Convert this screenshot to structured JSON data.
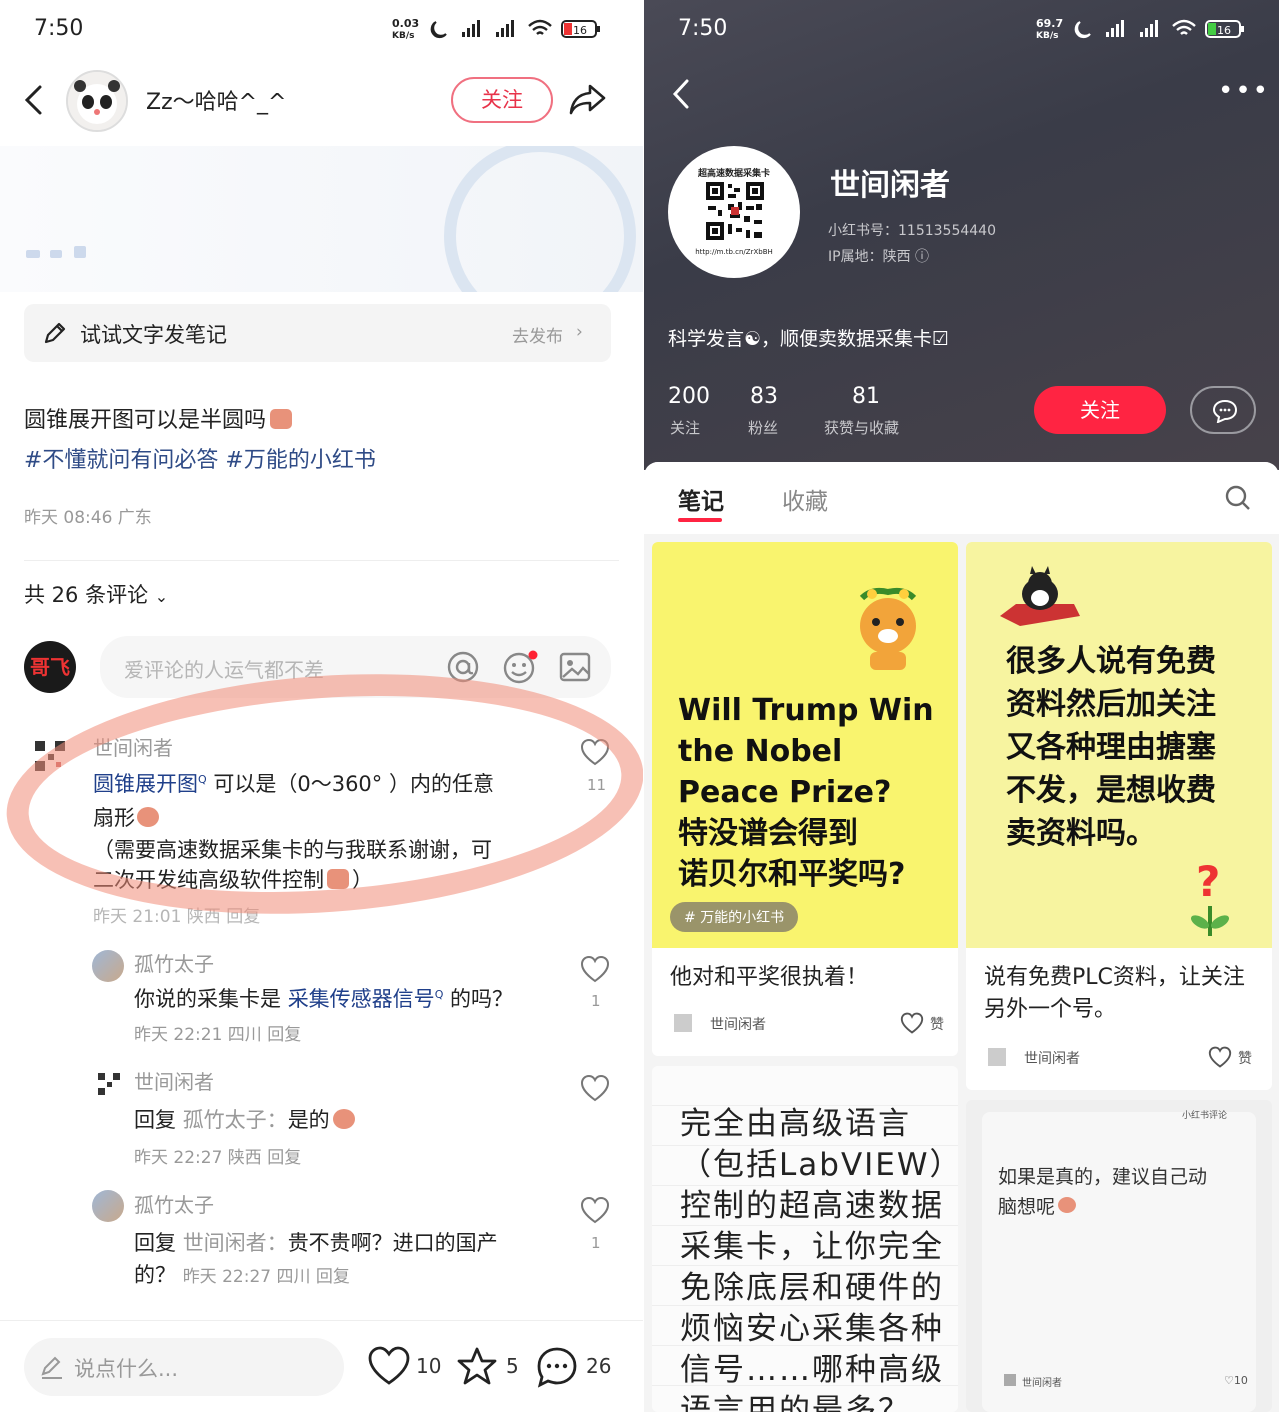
{
  "left": {
    "status": {
      "time": "7:50",
      "speed": "0.03\nKB/s",
      "battery": "16"
    },
    "header": {
      "username": "Zz～哈哈^_^",
      "follow_label": "关注"
    },
    "trybar": {
      "label": "试试文字发笔记",
      "action": "去发布"
    },
    "post": {
      "text": "圆锥展开图可以是半圆吗",
      "tags": "#不懂就问有问必答 #万能的小红书",
      "meta": "昨天 08:46 广东"
    },
    "comments_count": "共 26 条评论",
    "comment_placeholder": "爱评论的人运气都不差",
    "my_avatar_text": "哥飞",
    "comments": [
      {
        "author": "世间闲者",
        "link": "圆锥展开图",
        "text": " 可以是（0～360°  ）内的任意",
        "text2": "扇形",
        "text3": "（需要高速数据采集卡的与我联系谢谢，可",
        "text4": "二次开发纯高级软件控制",
        "text5": "）",
        "meta": "昨天 21:01 陕西  回复",
        "likes": "11"
      },
      {
        "author": "孤竹太子",
        "pre": "你说的采集卡是 ",
        "link": "采集传感器信号",
        "post": " 的吗？",
        "meta": "昨天 22:21 四川  回复",
        "likes": "1"
      },
      {
        "author": "世间闲者",
        "pre": "回复 ",
        "target": "孤竹太子：",
        "post": "是的",
        "meta": "昨天 22:27 陕西  回复",
        "likes": ""
      },
      {
        "author": "孤竹太子",
        "pre": "回复 ",
        "target": "世间闲者：",
        "post": "贵不贵啊？进口的国产",
        "post2": "的？",
        "meta": "昨天 22:27 四川  回复",
        "likes": "1"
      }
    ],
    "bottom": {
      "input": "说点什么...",
      "likes": "10",
      "stars": "5",
      "comments": "26"
    }
  },
  "right": {
    "status": {
      "time": "7:50",
      "speed": "69.7\nKB/s",
      "battery": "16"
    },
    "profile": {
      "name": "世间闲者",
      "qr_title": "超高速数据采集卡",
      "qr_url": "http://m.tb.cn/ZrXbBH",
      "id": "小红书号：11513554440",
      "ip": "IP属地：陕西",
      "bio": "科学发言☯，顺便卖数据采集卡☑",
      "stats": [
        {
          "num": "200",
          "label": "关注"
        },
        {
          "num": "83",
          "label": "粉丝"
        },
        {
          "num": "81",
          "label": "获赞与收藏"
        }
      ],
      "follow_label": "关注"
    },
    "tabs": [
      "笔记",
      "收藏"
    ],
    "cards": [
      {
        "cover_lines": [
          "Will Trump Win",
          "the Nobel",
          "Peace Prize?",
          "特没谱会得到",
          "诺贝尔和平奖吗?"
        ],
        "tag": "万能的小红书",
        "title": "他对和平奖很执着！",
        "author": "世间闲者",
        "like": "赞"
      },
      {
        "cover_lines": [
          "很多人说有免费",
          "资料然后加关注",
          "又各种理由搪塞",
          "不发，是想收费",
          "卖资料吗。"
        ],
        "title": "说有免费PLC资料，让关注另外一个号。",
        "author": "世间闲者",
        "like": "赞"
      },
      {
        "cover_lines": [
          "完全由高级语言",
          "（包括LabVIEW）",
          "控制的超高速数据",
          "采集卡，让你完全",
          "免除底层和硬件的",
          "烦恼安心采集各种",
          "信号……哪种高级",
          "语言用的最多？"
        ]
      },
      {
        "badge": "小红书评论",
        "cover_lines": [
          "如果是真的，建议自己动",
          "脑想呢"
        ],
        "author": "世间闲者",
        "likes": "10"
      }
    ]
  }
}
